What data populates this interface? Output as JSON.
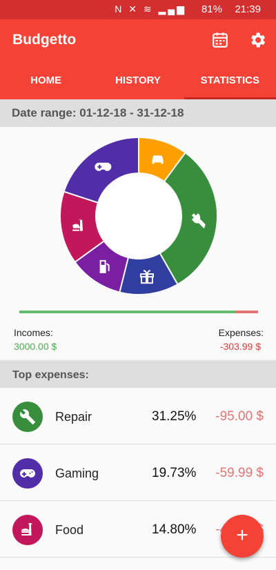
{
  "status_bar": {
    "battery": "81%",
    "time": "21:39",
    "icons": [
      "nfc-icon",
      "mute-icon",
      "wifi-icon",
      "signal-icon",
      "battery-icon"
    ]
  },
  "app": {
    "title": "Budgetto"
  },
  "tabs": [
    {
      "label": "HOME",
      "active": false
    },
    {
      "label": "HISTORY",
      "active": false
    },
    {
      "label": "STATISTICS",
      "active": true
    }
  ],
  "date_range": {
    "text": "Date range: 01-12-18  -  31-12-18"
  },
  "summary": {
    "incomes_label": "Incomes:",
    "incomes_value": "3000.00 $",
    "expenses_label": "Expenses:",
    "expenses_value": "-303.99 $"
  },
  "top_expenses": {
    "header": "Top expenses:",
    "items": [
      {
        "name": "Repair",
        "percent": "31.25%",
        "amount": "-95.00 $",
        "color": "#388e3c",
        "icon": "wrench-icon"
      },
      {
        "name": "Gaming",
        "percent": "19.73%",
        "amount": "-59.99 $",
        "color": "#512da8",
        "icon": "gamepad-icon"
      },
      {
        "name": "Food",
        "percent": "14.80%",
        "amount": "-45.00 $",
        "color": "#c2185b",
        "icon": "food-icon"
      }
    ]
  },
  "chart_data": {
    "type": "pie",
    "style": "donut",
    "slices": [
      {
        "category": "Transport",
        "share": 0.1,
        "color": "#ffa000",
        "icon": "car-icon"
      },
      {
        "category": "Repair",
        "share": 0.3125,
        "color": "#388e3c",
        "icon": "wrench-icon"
      },
      {
        "category": "Gifts",
        "share": 0.12,
        "color": "#303f9f",
        "icon": "gift-icon"
      },
      {
        "category": "Fuel",
        "share": 0.11,
        "color": "#7b1fa2",
        "icon": "fuel-icon"
      },
      {
        "category": "Food",
        "share": 0.148,
        "color": "#c2185b",
        "icon": "food-icon"
      },
      {
        "category": "Gaming",
        "share": 0.1973,
        "color": "#512da8",
        "icon": "gamepad-icon"
      }
    ]
  },
  "balance_bar": {
    "income_share": 0.908,
    "expense_share": 0.092,
    "income_color": "#66bb6a",
    "expense_color": "#e57373"
  },
  "fab": {
    "label": "+"
  }
}
